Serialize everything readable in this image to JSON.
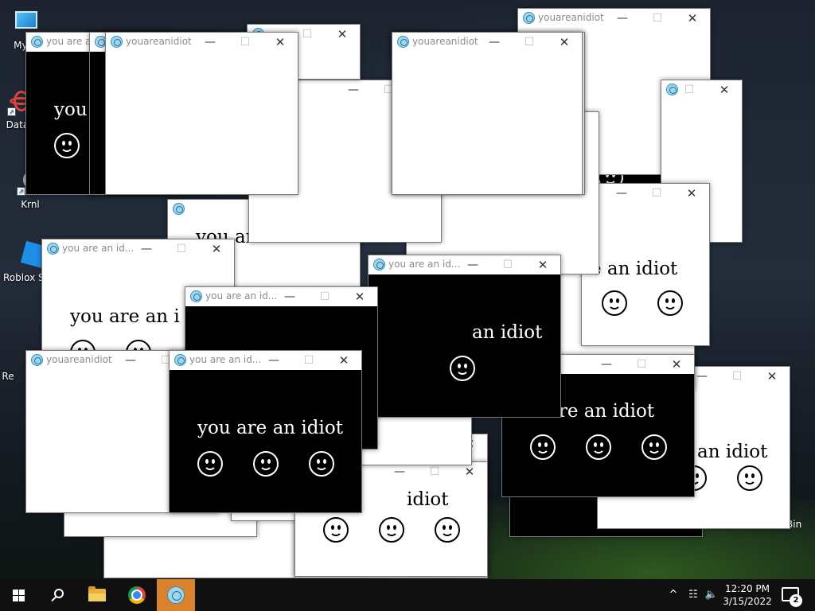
{
  "desktop_icons": [
    {
      "label": "My C",
      "icon": "computer-icon"
    },
    {
      "label": "DataV",
      "icon": "datavis-icon"
    },
    {
      "label": "Krnl",
      "icon": "krnl-icon"
    },
    {
      "label": "Roblox St",
      "icon": "roblox-studio-icon"
    },
    {
      "label": "Re",
      "icon": "recycle-bin-icon"
    }
  ],
  "recycle_label_fragment": "Bin",
  "windows": [
    {
      "title": "",
      "body": "white",
      "message": "",
      "smileys": 0
    },
    {
      "title": "",
      "body": "white",
      "message": "",
      "smileys": 0
    },
    {
      "title": "",
      "body": "white",
      "message": "",
      "smileys": 0
    },
    {
      "title": "",
      "body": "black",
      "message": "",
      "smileys": 0
    },
    {
      "title": "",
      "body": "white",
      "message": "an idiot",
      "smileys": 2
    },
    {
      "title": "",
      "body": "white",
      "message": "an idiot",
      "smileys": 2
    },
    {
      "title": "",
      "body": "white",
      "message": "",
      "smileys": 0
    },
    {
      "title": "",
      "body": "black",
      "message": "idiot",
      "smileys": 1
    },
    {
      "title": "youareanidiot",
      "body": "white",
      "message": "",
      "smileys": 0
    },
    {
      "title": "",
      "body": "white",
      "message": "",
      "smileys": 0
    },
    {
      "title": "",
      "body": "white",
      "message": "re an idiot",
      "smileys": 2
    },
    {
      "title": "",
      "body": "white",
      "message": "you ar",
      "smileys": 1
    },
    {
      "title": "you are an id...",
      "body": "white",
      "message": "",
      "smileys": 0
    },
    {
      "title": "",
      "body": "white",
      "message": "idiot",
      "smileys": 3
    },
    {
      "title": "",
      "body": "black",
      "message": "u are an idiot",
      "smileys": 3
    },
    {
      "title": "you are an id...",
      "body": "white",
      "message": "you are an i",
      "smileys": 2
    },
    {
      "title": "",
      "body": "white",
      "message": "",
      "smileys": 0
    },
    {
      "title": "you are an id...",
      "body": "black",
      "message": "an idiot",
      "smileys": 1
    },
    {
      "title": "you are an id...",
      "body": "black",
      "message": "",
      "smileys": 0
    },
    {
      "title": "youareanidiot",
      "body": "white",
      "message": "",
      "smileys": 0
    },
    {
      "title": "you are an id...",
      "body": "black",
      "message": "you are an idiot",
      "smileys": 3
    },
    {
      "title": "",
      "body": "black",
      "message": "",
      "smileys": 0
    },
    {
      "title": "",
      "body": "white",
      "message": "",
      "smileys": 0
    },
    {
      "title": "you are an id...",
      "body": "white",
      "message": "",
      "smileys": 0
    },
    {
      "title": "",
      "body": "white",
      "message": "",
      "smileys": 0
    },
    {
      "title": "youareanidiot",
      "body": "white",
      "message": "",
      "smileys": 0
    },
    {
      "title": "you are an id...",
      "body": "black",
      "message": "you",
      "smileys": 1
    },
    {
      "title": "",
      "body": "black",
      "message": "",
      "smileys": 0
    },
    {
      "title": "youareanidiot",
      "body": "white",
      "message": "",
      "smileys": 0
    }
  ],
  "taskbar": {
    "start": "windows-start-icon",
    "pinned": [
      {
        "name": "search-icon"
      },
      {
        "name": "file-explorer-icon"
      },
      {
        "name": "chrome-icon"
      },
      {
        "name": "youareanidiot-app-icon",
        "active": true
      }
    ],
    "tray": {
      "chevron": "^",
      "network": "network-icon",
      "volume": "speaker-icon",
      "time": "12:20 PM",
      "date": "3/15/2022",
      "notification_count": "2"
    }
  },
  "colors": {
    "taskbar": "#101010",
    "active_app": "#d9822b"
  }
}
